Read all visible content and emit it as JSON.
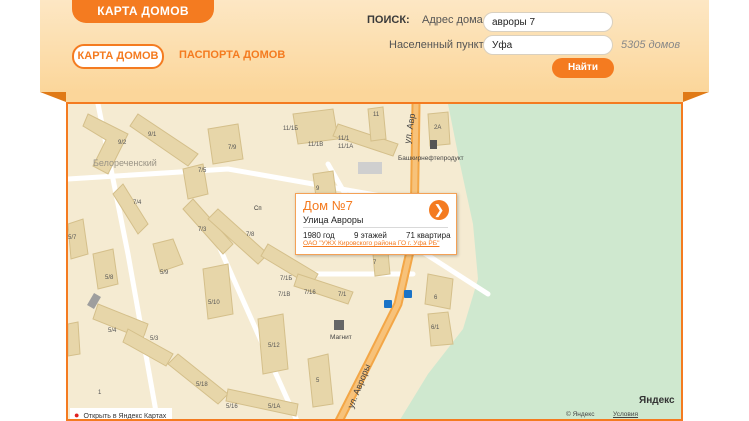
{
  "header": {
    "logo": "КАРТА ДОМОВ",
    "nav": {
      "active": "КАРТА ДОМОВ",
      "second": "ПАСПОРТА ДОМОВ"
    }
  },
  "search": {
    "label": "ПОИСК:",
    "address_label": "Адрес дома",
    "address_value": "авроры 7",
    "city_label": "Населенный пункт",
    "city_value": "Уфа",
    "count": "5305 домов",
    "button": "Найти"
  },
  "map": {
    "district": "Белореченский",
    "street": "ул. Авроры",
    "street_top": "ул. Авр",
    "poi_gas": "Башкирнефтепродукт",
    "poi_shop": "Магнит",
    "poi_partial": "Сп",
    "house_labels": [
      "9/1",
      "9/2",
      "7/9",
      "7/5",
      "7/4",
      "7/3",
      "7/8",
      "5/7",
      "5/8",
      "5/9",
      "5/10",
      "5/4",
      "5/3",
      "5/18",
      "5/16",
      "5/1А",
      "5/12",
      "7/1Б",
      "7/1В",
      "7/16",
      "7/1",
      "11/1Б",
      "11/1В",
      "11/1",
      "11/1А",
      "11",
      "9",
      "7",
      "2А",
      "6",
      "6/1",
      "5"
    ],
    "open_link": "Открыть в Яндекс Картах",
    "logo": "Яндекс",
    "copyright": "© Яндекс",
    "terms": "Условия использования"
  },
  "popup": {
    "title": "Дом №7",
    "street": "Улица Авроры",
    "year": "1980 год",
    "floors": "9 этажей",
    "apartments": "71 квартира",
    "company": "ОАО \"УЖХ Кировского района ГО г. Уфа РБ\""
  }
}
